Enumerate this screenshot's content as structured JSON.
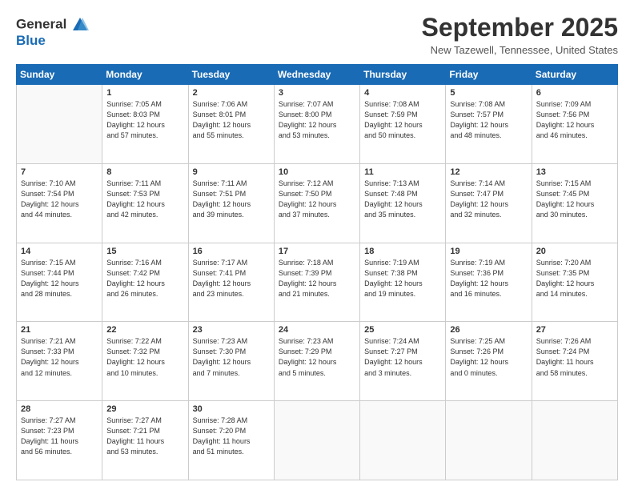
{
  "logo": {
    "line1": "General",
    "line2": "Blue"
  },
  "header": {
    "month": "September 2025",
    "location": "New Tazewell, Tennessee, United States"
  },
  "weekdays": [
    "Sunday",
    "Monday",
    "Tuesday",
    "Wednesday",
    "Thursday",
    "Friday",
    "Saturday"
  ],
  "weeks": [
    [
      {
        "day": "",
        "info": ""
      },
      {
        "day": "1",
        "info": "Sunrise: 7:05 AM\nSunset: 8:03 PM\nDaylight: 12 hours\nand 57 minutes."
      },
      {
        "day": "2",
        "info": "Sunrise: 7:06 AM\nSunset: 8:01 PM\nDaylight: 12 hours\nand 55 minutes."
      },
      {
        "day": "3",
        "info": "Sunrise: 7:07 AM\nSunset: 8:00 PM\nDaylight: 12 hours\nand 53 minutes."
      },
      {
        "day": "4",
        "info": "Sunrise: 7:08 AM\nSunset: 7:59 PM\nDaylight: 12 hours\nand 50 minutes."
      },
      {
        "day": "5",
        "info": "Sunrise: 7:08 AM\nSunset: 7:57 PM\nDaylight: 12 hours\nand 48 minutes."
      },
      {
        "day": "6",
        "info": "Sunrise: 7:09 AM\nSunset: 7:56 PM\nDaylight: 12 hours\nand 46 minutes."
      }
    ],
    [
      {
        "day": "7",
        "info": "Sunrise: 7:10 AM\nSunset: 7:54 PM\nDaylight: 12 hours\nand 44 minutes."
      },
      {
        "day": "8",
        "info": "Sunrise: 7:11 AM\nSunset: 7:53 PM\nDaylight: 12 hours\nand 42 minutes."
      },
      {
        "day": "9",
        "info": "Sunrise: 7:11 AM\nSunset: 7:51 PM\nDaylight: 12 hours\nand 39 minutes."
      },
      {
        "day": "10",
        "info": "Sunrise: 7:12 AM\nSunset: 7:50 PM\nDaylight: 12 hours\nand 37 minutes."
      },
      {
        "day": "11",
        "info": "Sunrise: 7:13 AM\nSunset: 7:48 PM\nDaylight: 12 hours\nand 35 minutes."
      },
      {
        "day": "12",
        "info": "Sunrise: 7:14 AM\nSunset: 7:47 PM\nDaylight: 12 hours\nand 32 minutes."
      },
      {
        "day": "13",
        "info": "Sunrise: 7:15 AM\nSunset: 7:45 PM\nDaylight: 12 hours\nand 30 minutes."
      }
    ],
    [
      {
        "day": "14",
        "info": "Sunrise: 7:15 AM\nSunset: 7:44 PM\nDaylight: 12 hours\nand 28 minutes."
      },
      {
        "day": "15",
        "info": "Sunrise: 7:16 AM\nSunset: 7:42 PM\nDaylight: 12 hours\nand 26 minutes."
      },
      {
        "day": "16",
        "info": "Sunrise: 7:17 AM\nSunset: 7:41 PM\nDaylight: 12 hours\nand 23 minutes."
      },
      {
        "day": "17",
        "info": "Sunrise: 7:18 AM\nSunset: 7:39 PM\nDaylight: 12 hours\nand 21 minutes."
      },
      {
        "day": "18",
        "info": "Sunrise: 7:19 AM\nSunset: 7:38 PM\nDaylight: 12 hours\nand 19 minutes."
      },
      {
        "day": "19",
        "info": "Sunrise: 7:19 AM\nSunset: 7:36 PM\nDaylight: 12 hours\nand 16 minutes."
      },
      {
        "day": "20",
        "info": "Sunrise: 7:20 AM\nSunset: 7:35 PM\nDaylight: 12 hours\nand 14 minutes."
      }
    ],
    [
      {
        "day": "21",
        "info": "Sunrise: 7:21 AM\nSunset: 7:33 PM\nDaylight: 12 hours\nand 12 minutes."
      },
      {
        "day": "22",
        "info": "Sunrise: 7:22 AM\nSunset: 7:32 PM\nDaylight: 12 hours\nand 10 minutes."
      },
      {
        "day": "23",
        "info": "Sunrise: 7:23 AM\nSunset: 7:30 PM\nDaylight: 12 hours\nand 7 minutes."
      },
      {
        "day": "24",
        "info": "Sunrise: 7:23 AM\nSunset: 7:29 PM\nDaylight: 12 hours\nand 5 minutes."
      },
      {
        "day": "25",
        "info": "Sunrise: 7:24 AM\nSunset: 7:27 PM\nDaylight: 12 hours\nand 3 minutes."
      },
      {
        "day": "26",
        "info": "Sunrise: 7:25 AM\nSunset: 7:26 PM\nDaylight: 12 hours\nand 0 minutes."
      },
      {
        "day": "27",
        "info": "Sunrise: 7:26 AM\nSunset: 7:24 PM\nDaylight: 11 hours\nand 58 minutes."
      }
    ],
    [
      {
        "day": "28",
        "info": "Sunrise: 7:27 AM\nSunset: 7:23 PM\nDaylight: 11 hours\nand 56 minutes."
      },
      {
        "day": "29",
        "info": "Sunrise: 7:27 AM\nSunset: 7:21 PM\nDaylight: 11 hours\nand 53 minutes."
      },
      {
        "day": "30",
        "info": "Sunrise: 7:28 AM\nSunset: 7:20 PM\nDaylight: 11 hours\nand 51 minutes."
      },
      {
        "day": "",
        "info": ""
      },
      {
        "day": "",
        "info": ""
      },
      {
        "day": "",
        "info": ""
      },
      {
        "day": "",
        "info": ""
      }
    ]
  ]
}
